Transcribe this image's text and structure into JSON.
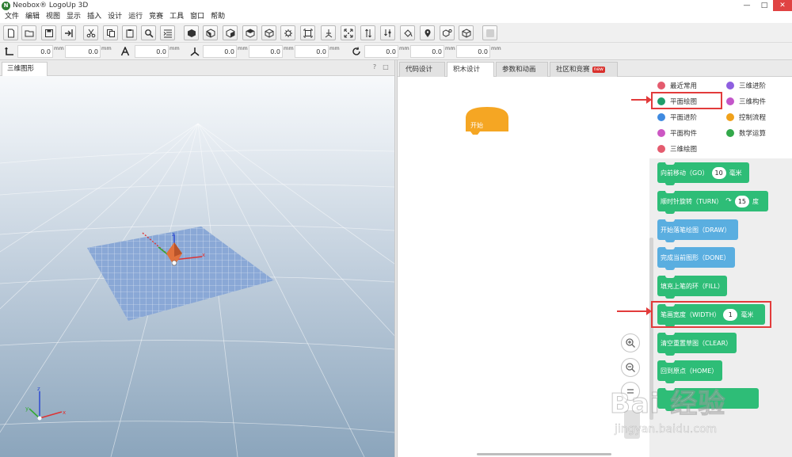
{
  "window": {
    "title": "Neobox® LogoUp 3D"
  },
  "menu": [
    "文件",
    "编辑",
    "视图",
    "显示",
    "插入",
    "设计",
    "运行",
    "竞赛",
    "工具",
    "窗口",
    "帮助"
  ],
  "toolbar2": {
    "fields": [
      "0.0",
      "0.0",
      "0.0",
      "0.0",
      "0.0",
      "0.0",
      "0.0",
      "0.0",
      "0.0"
    ],
    "unit": "mm"
  },
  "left_panel": {
    "tab": "三维图形"
  },
  "right_tabs": [
    "代码设计",
    "积木设计",
    "参数和动画",
    "社区和竞赛"
  ],
  "new_badge": "new",
  "workspace": {
    "start_block": "开始"
  },
  "categories": [
    {
      "label": "最近常用",
      "color": "#e45b6e"
    },
    {
      "label": "三维进阶",
      "color": "#8e5fe0"
    },
    {
      "label": "平面绘图",
      "color": "#1f9e6a"
    },
    {
      "label": "三维构件",
      "color": "#c356c9"
    },
    {
      "label": "平面进阶",
      "color": "#3f8ae0"
    },
    {
      "label": "控制流程",
      "color": "#f0a11b"
    },
    {
      "label": "平面构件",
      "color": "#cc57c3"
    },
    {
      "label": "数学运算",
      "color": "#32a84a"
    },
    {
      "label": "三维绘图",
      "color": "#e45b6e"
    }
  ],
  "blocks": {
    "go": {
      "label": "向前移动（GO）",
      "value": "10",
      "unit": "毫米"
    },
    "turn": {
      "label": "顺时针旋转（TURN）",
      "icon": "↷",
      "value": "15",
      "unit": "度"
    },
    "draw": {
      "label": "开始落笔绘图（DRAW）"
    },
    "done": {
      "label": "完成当前图形（DONE）"
    },
    "fill": {
      "label": "填充上笔的环（FILL）"
    },
    "width": {
      "label": "笔画宽度（WIDTH）",
      "value": "1",
      "unit": "毫米"
    },
    "clear": {
      "label": "清空重置草图（CLEAR）"
    },
    "home": {
      "label": "回到原点（HOME）"
    }
  },
  "axes": {
    "x": "x",
    "y": "y",
    "z": "z"
  },
  "watermark": {
    "main": "Bai 经验",
    "sub": "jingyan.baidu.com"
  }
}
